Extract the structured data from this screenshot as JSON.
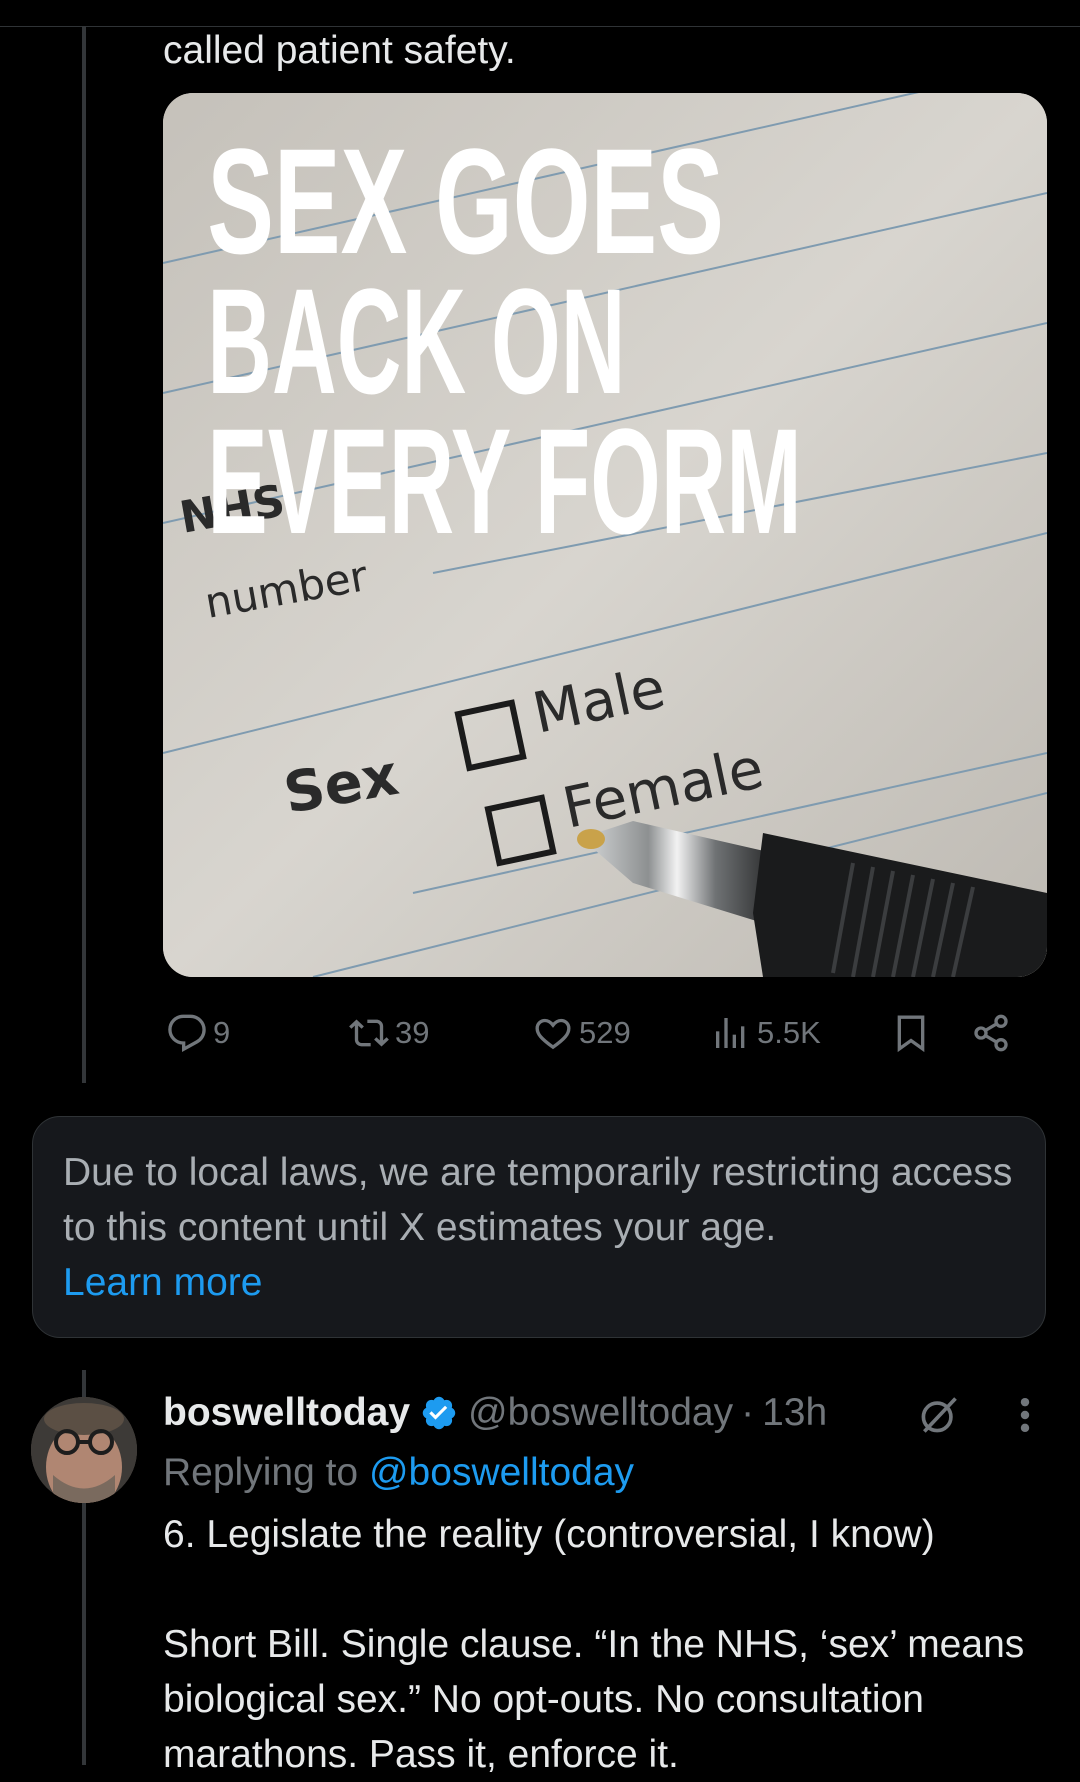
{
  "prev_tweet": {
    "tail_text": "called patient safety.",
    "image": {
      "headline": [
        "SEX GOES",
        "BACK ON",
        "EVERY FORM"
      ],
      "form_label_nhs": "NHS",
      "form_label_number": "number",
      "form_label_sex": "Sex",
      "option_male": "Male",
      "option_female": "Female"
    },
    "actions": {
      "replies": "9",
      "reposts": "39",
      "likes": "529",
      "views": "5.5K"
    }
  },
  "notice": {
    "text": "Due to local laws, we are temporarily restricting access to this content until X estimates your age.",
    "link": "Learn more"
  },
  "tweet": {
    "display_name": "boswelltoday",
    "handle": "@boswelltoday",
    "separator": "·",
    "time": "13h",
    "replying_prefix": "Replying to",
    "replying_to": "@boswelltoday",
    "line1": "6. Legislate the reality (controversial, I know)",
    "line2": "Short Bill. Single clause. “In the NHS, ‘sex’ means biological sex.” No opt-outs. No consultation marathons. Pass it, enforce it."
  },
  "colors": {
    "background": "#000000",
    "text": "#e7e9ea",
    "muted": "#71767b",
    "accent": "#1d9bf0",
    "notice_bg": "#16181c"
  },
  "icons": [
    "reply-icon",
    "repost-icon",
    "like-icon",
    "views-icon",
    "bookmark-icon",
    "share-icon",
    "verified-badge-icon",
    "grok-icon",
    "more-icon"
  ]
}
